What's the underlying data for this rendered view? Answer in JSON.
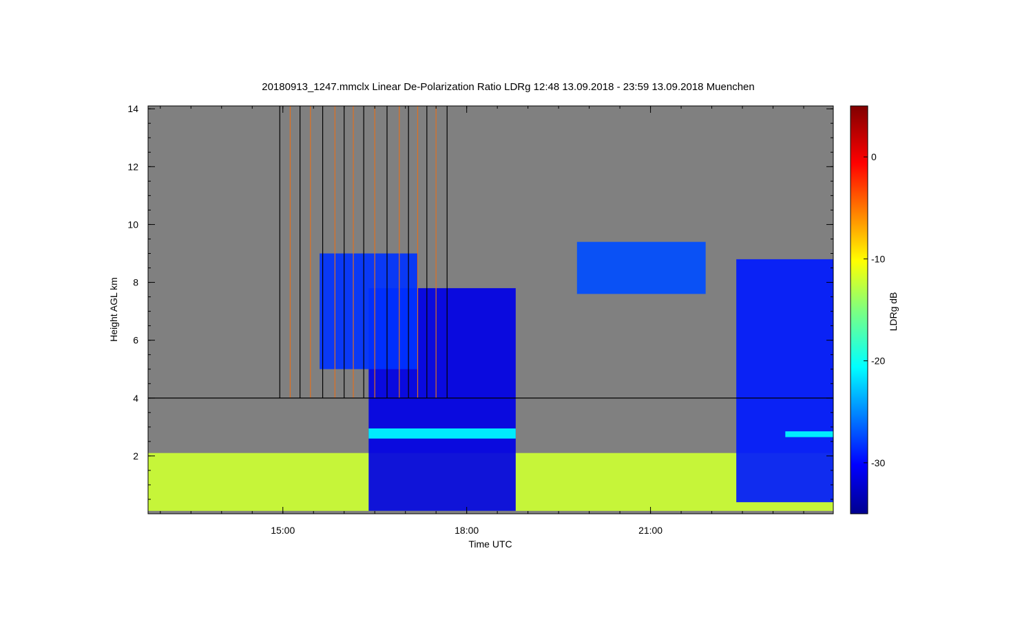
{
  "chart_data": {
    "type": "heatmap",
    "title": "20180913_1247.mmclx Linear De-Polarization Ratio LDRg   12:48 13.09.2018 - 23:59 13.09.2018 Muenchen",
    "xlabel": "Time UTC",
    "ylabel": "Height AGL km",
    "colorbar_label": "LDRg dB",
    "x_range_hours": [
      12.8,
      23.983
    ],
    "y_range_km": [
      0.0,
      14.1
    ],
    "x_ticks": [
      {
        "value": 15,
        "label": "15:00"
      },
      {
        "value": 18,
        "label": "18:00"
      },
      {
        "value": 21,
        "label": "21:00"
      }
    ],
    "y_ticks": [
      {
        "value": 2,
        "label": "2"
      },
      {
        "value": 4,
        "label": "4"
      },
      {
        "value": 6,
        "label": "6"
      },
      {
        "value": 8,
        "label": "8"
      },
      {
        "value": 10,
        "label": "10"
      },
      {
        "value": 12,
        "label": "12"
      },
      {
        "value": 14,
        "label": "14"
      }
    ],
    "colorbar_range_db": [
      -35,
      5
    ],
    "colorbar_ticks": [
      {
        "value": 0,
        "label": "0"
      },
      {
        "value": -10,
        "label": "-10"
      },
      {
        "value": -20,
        "label": "-20"
      },
      {
        "value": -30,
        "label": "-30"
      }
    ],
    "background_color": "#808080",
    "colormap": "jet",
    "reference_line_km": 4.0,
    "features": [
      {
        "name": "low clutter layer",
        "t_start": 12.8,
        "t_end": 23.983,
        "h_bottom": 0.1,
        "h_top": 2.1,
        "ldr_db": -12
      },
      {
        "name": "precipitation / cloud core",
        "t_start": 16.4,
        "t_end": 18.8,
        "h_bottom": 0.1,
        "h_top": 7.8,
        "ldr_db": -31
      },
      {
        "name": "melting layer",
        "t_start": 16.4,
        "t_end": 18.8,
        "h_bottom": 2.6,
        "h_top": 2.95,
        "ldr_db": -20
      },
      {
        "name": "upper cloud",
        "t_start": 15.6,
        "t_end": 17.2,
        "h_bottom": 5.0,
        "h_top": 9.0,
        "ldr_db": -28
      },
      {
        "name": "evening cirrus",
        "t_start": 19.8,
        "t_end": 21.9,
        "h_bottom": 7.6,
        "h_top": 9.4,
        "ldr_db": -27
      },
      {
        "name": "late cloud / precipitation",
        "t_start": 22.4,
        "t_end": 23.983,
        "h_bottom": 0.4,
        "h_top": 8.8,
        "ldr_db": -29
      },
      {
        "name": "late melting layer",
        "t_start": 23.2,
        "t_end": 23.983,
        "h_bottom": 2.65,
        "h_top": 2.85,
        "ldr_db": -20
      }
    ],
    "spike_times": [
      14.95,
      15.12,
      15.28,
      15.45,
      15.65,
      15.85,
      16.0,
      16.15,
      16.32,
      16.5,
      16.7,
      16.9,
      17.05,
      17.2,
      17.35,
      17.5,
      17.68
    ]
  }
}
